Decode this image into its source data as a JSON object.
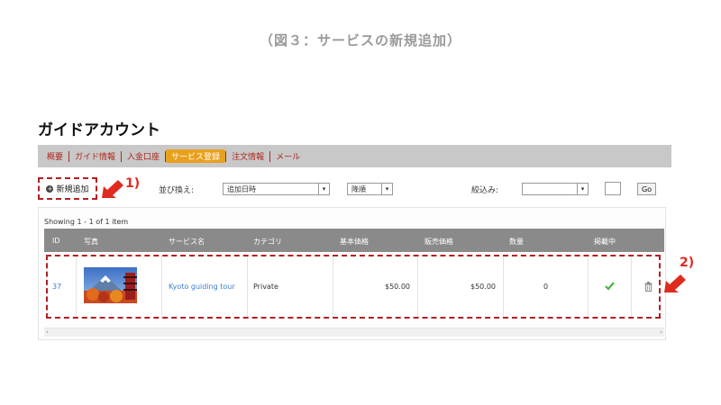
{
  "figure_caption": "（図３：サービスの新規追加）",
  "page_title": "ガイドアカウント",
  "nav": {
    "items": [
      "概要",
      "ガイド情報",
      "入金口座",
      "サービス登録",
      "注文情報",
      "メール"
    ],
    "active_index": 3
  },
  "toolbar": {
    "add_button_label": "新規追加",
    "sort_label": "並び換え:",
    "sort_field_value": "追加日時",
    "sort_order_value": "降順",
    "filter_label": "絞込み:",
    "filter_value": "",
    "filter_text_value": "",
    "go_label": "Go"
  },
  "annotations": {
    "one": "1)",
    "two": "2)",
    "accent_color": "#e02a1e"
  },
  "table": {
    "showing_text": "Showing 1 - 1 of 1 item",
    "columns": [
      "ID",
      "写真",
      "サービス名",
      "カテゴリ",
      "基本価格",
      "販売価格",
      "数量",
      "掲載中"
    ],
    "rows": [
      {
        "id": "37",
        "photo": "mountain-photo",
        "service_name": "Kyoto guiding tour",
        "category": "Private",
        "base_price": "$50.00",
        "sale_price": "$50.00",
        "quantity": "0",
        "published": true
      }
    ]
  },
  "colors": {
    "nav_bg": "#c8c8c8",
    "nav_text": "#b0271c",
    "nav_active_bg": "#e8a11d",
    "header_bg": "#8a8a8a",
    "link": "#3a7ecf",
    "check": "#4ab348"
  }
}
